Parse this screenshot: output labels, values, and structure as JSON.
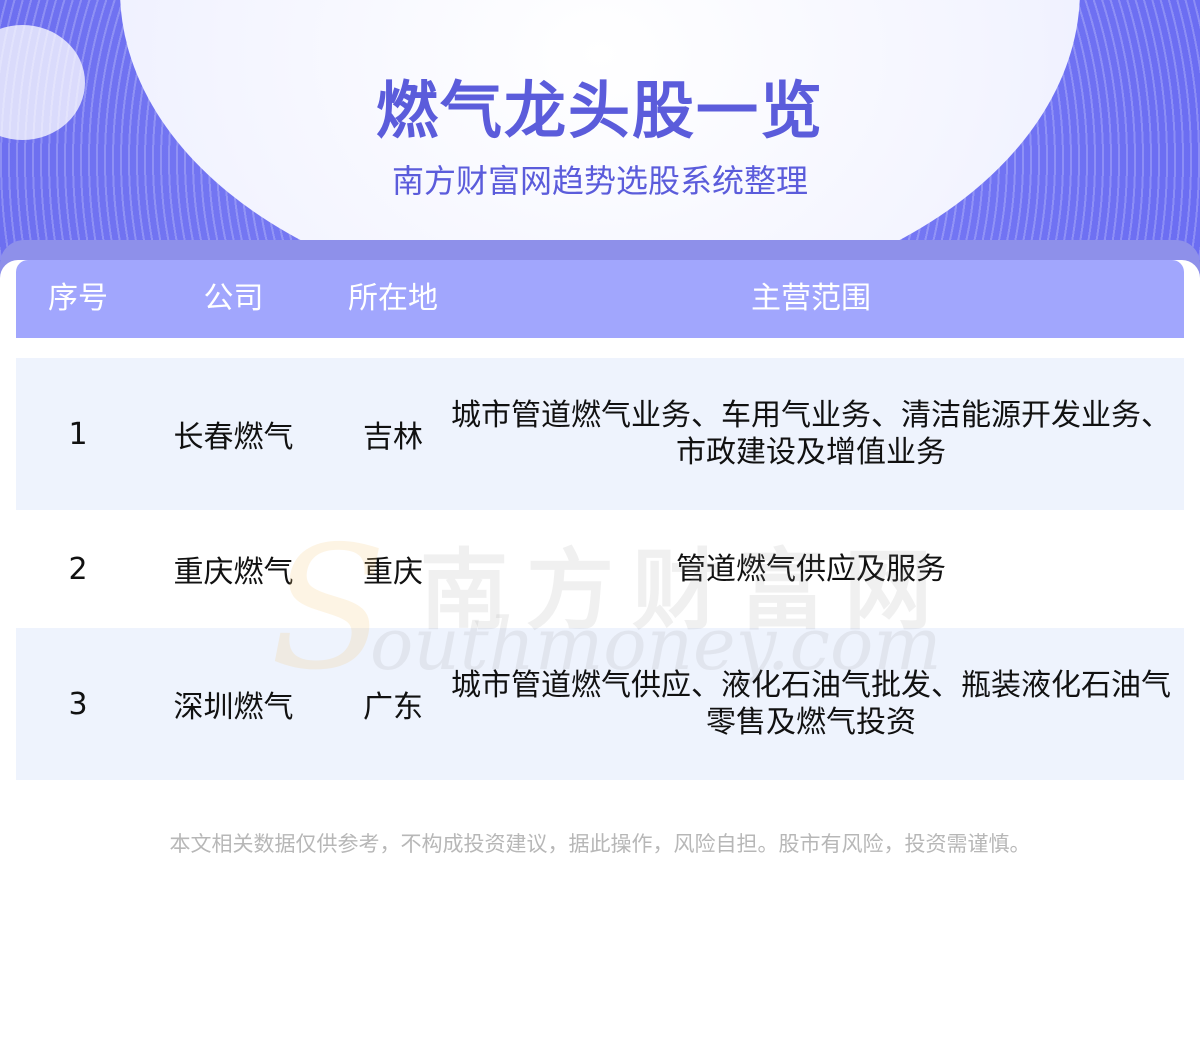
{
  "header": {
    "title": "燃气龙头股一览",
    "subtitle": "南方财富网趋势选股系统整理"
  },
  "table": {
    "columns": [
      "序号",
      "公司",
      "所在地",
      "主营范围"
    ],
    "rows": [
      {
        "idx": "1",
        "company": "长春燃气",
        "location": "吉林",
        "business": "城市管道燃气业务、车用气业务、清洁能源开发业务、市政建设及增值业务"
      },
      {
        "idx": "2",
        "company": "重庆燃气",
        "location": "重庆",
        "business": "管道燃气供应及服务"
      },
      {
        "idx": "3",
        "company": "深圳燃气",
        "location": "广东",
        "business": "城市管道燃气供应、液化石油气批发、瓶装液化石油气零售及燃气投资"
      }
    ]
  },
  "watermark": {
    "cn": "南方财富网",
    "en": "outhmoney.com",
    "logo_letter": "S"
  },
  "footer": {
    "disclaimer": "本文相关数据仅供参考，不构成投资建议，据此操作，风险自担。股市有风险，投资需谨慎。"
  },
  "colors": {
    "accent": "#5b5cdb",
    "header_row": "#a1a6fd",
    "row_shade": "#eef3fd"
  }
}
